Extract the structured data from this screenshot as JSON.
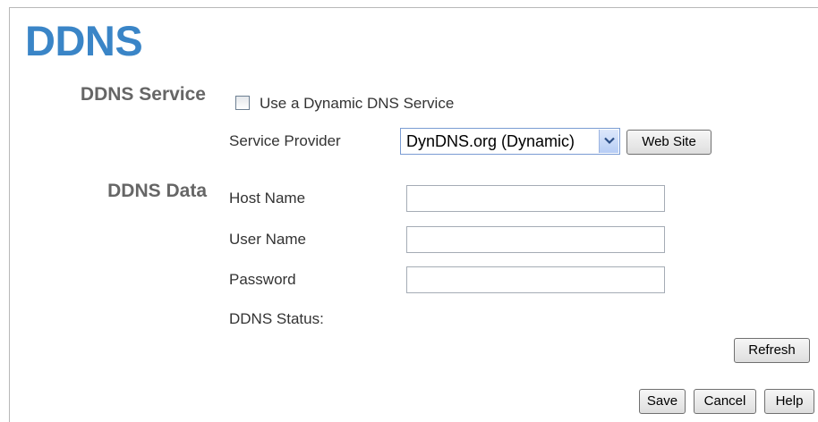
{
  "page": {
    "title": "DDNS"
  },
  "ddns_service": {
    "section_label": "DDNS Service",
    "use_dynamic_dns_label": "Use a Dynamic DNS Service",
    "use_dynamic_dns_checked": false,
    "service_provider_label": "Service Provider",
    "service_provider_value": "DynDNS.org (Dynamic)",
    "web_site_button": "Web Site"
  },
  "ddns_data": {
    "section_label": "DDNS Data",
    "host_name_label": "Host Name",
    "host_name_value": "",
    "user_name_label": "User Name",
    "user_name_value": "",
    "password_label": "Password",
    "password_value": "",
    "status_label": "DDNS Status:",
    "status_value": ""
  },
  "buttons": {
    "refresh": "Refresh",
    "save": "Save",
    "cancel": "Cancel",
    "help": "Help"
  },
  "colors": {
    "title": "#3a85c7",
    "section_label": "#666666"
  }
}
